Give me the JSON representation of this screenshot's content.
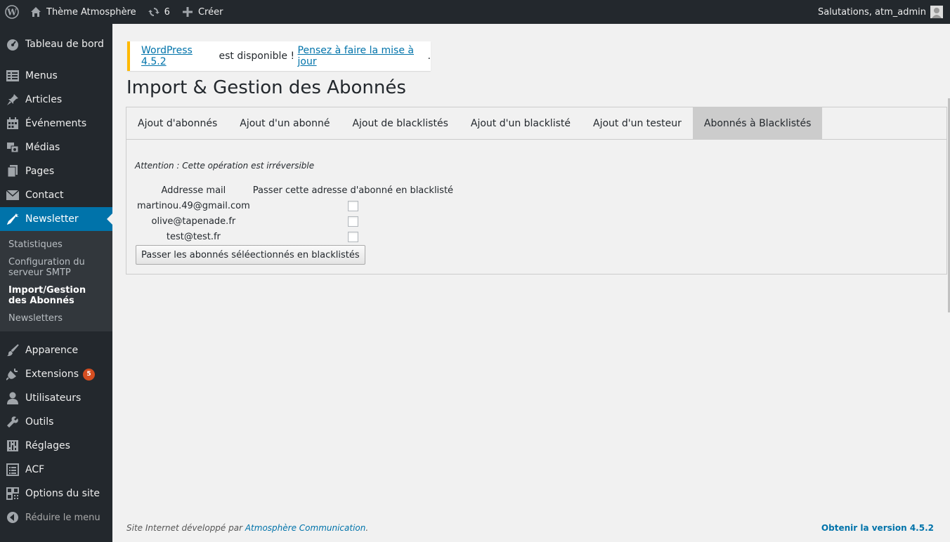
{
  "adminbar": {
    "site_name": "Thème Atmosphère",
    "updates_count": "6",
    "new_label": "Créer",
    "greeting": "Salutations, atm_admin"
  },
  "sidebar": {
    "items": [
      {
        "label": "Tableau de bord",
        "icon": "dashboard-icon"
      },
      {
        "label": "Menus",
        "icon": "menus-icon"
      },
      {
        "label": "Articles",
        "icon": "pin-icon"
      },
      {
        "label": "Événements",
        "icon": "calendar-icon"
      },
      {
        "label": "Médias",
        "icon": "media-icon"
      },
      {
        "label": "Pages",
        "icon": "pages-icon"
      },
      {
        "label": "Contact",
        "icon": "mail-icon"
      },
      {
        "label": "Newsletter",
        "icon": "carrot-icon"
      }
    ],
    "submenu": [
      {
        "label": "Statistiques"
      },
      {
        "label": "Configuration du serveur SMTP"
      },
      {
        "label": "Import/Gestion des Abonnés"
      },
      {
        "label": "Newsletters"
      }
    ],
    "items_bottom": [
      {
        "label": "Apparence",
        "icon": "brush-icon"
      },
      {
        "label": "Extensions",
        "icon": "plugin-icon",
        "badge": "5"
      },
      {
        "label": "Utilisateurs",
        "icon": "user-icon"
      },
      {
        "label": "Outils",
        "icon": "wrench-icon"
      },
      {
        "label": "Réglages",
        "icon": "settings-icon"
      },
      {
        "label": "ACF",
        "icon": "list-icon"
      },
      {
        "label": "Options du site",
        "icon": "grid-icon"
      }
    ],
    "collapse_label": "Réduire le menu"
  },
  "notice": {
    "link1": "WordPress 4.5.2",
    "text": " est disponible ! ",
    "link2": "Pensez à faire la mise à jour",
    "end": "."
  },
  "page": {
    "title": "Import & Gestion des Abonnés"
  },
  "tabs": [
    {
      "label": "Ajout d'abonnés"
    },
    {
      "label": "Ajout d'un abonné"
    },
    {
      "label": "Ajout de blacklistés"
    },
    {
      "label": "Ajout d'un blacklisté"
    },
    {
      "label": "Ajout d'un testeur"
    },
    {
      "label": "Abonnés à Blacklistés"
    }
  ],
  "panel": {
    "warning": "Attention : Cette opération est irréversible",
    "col_email": "Addresse mail",
    "col_action": "Passer cette adresse d'abonné en blacklisté",
    "rows": [
      {
        "email": "martinou.49@gmail.com"
      },
      {
        "email": "olive@tapenade.fr"
      },
      {
        "email": "test@test.fr"
      }
    ],
    "submit_label": "Passer les abonnés séléectionnés en blacklistés"
  },
  "footer": {
    "left_text": "Site Internet développé par ",
    "left_link": "Atmosphère Communication",
    "left_end": ".",
    "right_link": "Obtenir la version 4.5.2"
  },
  "colors": {
    "adminbar_bg": "#23282d",
    "accent": "#0073aa",
    "notice_border": "#ffb900",
    "badge": "#d54e21"
  }
}
